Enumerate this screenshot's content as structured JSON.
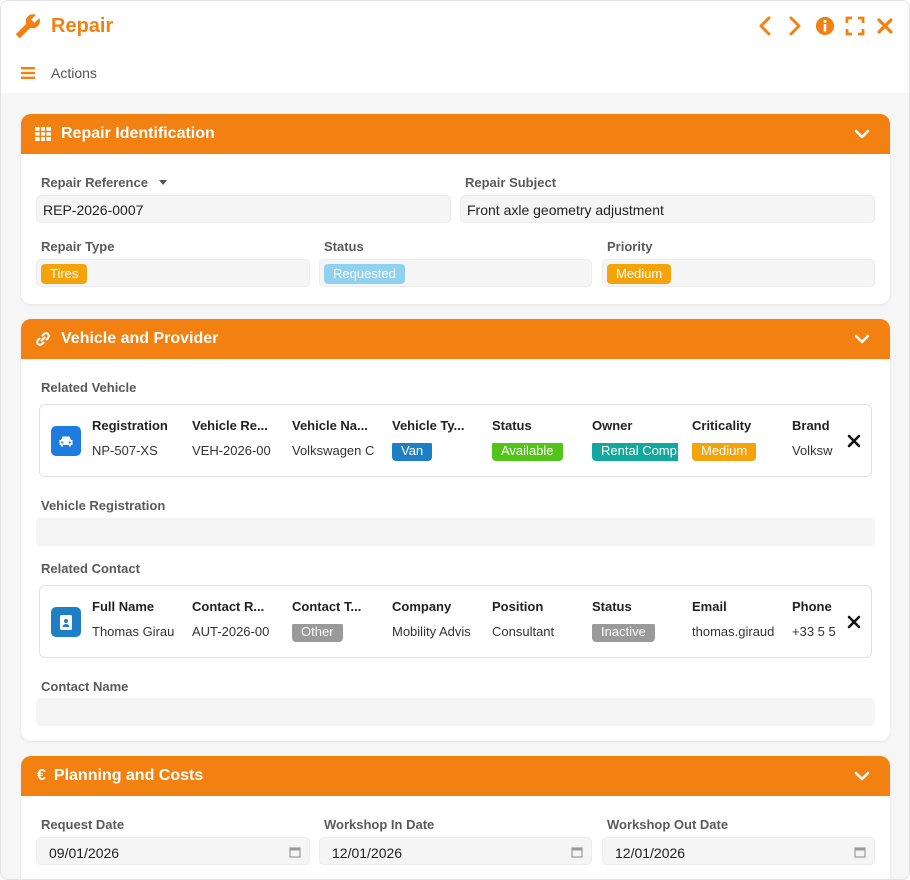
{
  "window": {
    "title": "Repair",
    "actions_label": "Actions"
  },
  "colors": {
    "accent": "#f28111"
  },
  "sections": {
    "identification": {
      "title": "Repair Identification",
      "repair_reference_label": "Repair Reference",
      "repair_reference_value": "REP-2026-0007",
      "repair_subject_label": "Repair Subject",
      "repair_subject_value": "Front axle geometry adjustment",
      "repair_type_label": "Repair Type",
      "repair_type_value": "Tires",
      "status_label": "Status",
      "status_value": "Requested",
      "priority_label": "Priority",
      "priority_value": "Medium"
    },
    "vehicle": {
      "title": "Vehicle and Provider",
      "related_vehicle_label": "Related Vehicle",
      "card": {
        "headers": [
          "Registration",
          "Vehicle Re...",
          "Vehicle Na...",
          "Vehicle Ty...",
          "Status",
          "Owner",
          "Criticality",
          "Brand"
        ],
        "values": [
          "NP-507-XS",
          "VEH-2026-00",
          "Volkswagen C",
          "Van",
          "Available",
          "Rental Comp",
          "Medium",
          "Volksw"
        ]
      },
      "vehicle_registration_label": "Vehicle Registration",
      "related_contact_label": "Related Contact",
      "contact_card": {
        "headers": [
          "Full Name",
          "Contact R...",
          "Contact T...",
          "Company",
          "Position",
          "Status",
          "Email",
          "Phone"
        ],
        "values": [
          "Thomas Girau",
          "AUT-2026-00",
          "Other",
          "Mobility Advis",
          "Consultant",
          "Inactive",
          "thomas.giraud",
          "+33 5 5"
        ]
      },
      "contact_name_label": "Contact Name"
    },
    "planning": {
      "title": "Planning and Costs",
      "request_date_label": "Request Date",
      "request_date_value": "09/01/2026",
      "workshop_in_label": "Workshop In Date",
      "workshop_in_value": "12/01/2026",
      "workshop_out_label": "Workshop Out Date",
      "workshop_out_value": "12/01/2026"
    }
  },
  "badge_colors": {
    "tires": "#f5a30a",
    "requested": "#8fd1ee",
    "medium": "#f5a30a",
    "van": "#1f7fc4",
    "available": "#52c41a",
    "rental": "#13a89e",
    "other": "#9a9a9a",
    "inactive": "#9a9a9a"
  }
}
